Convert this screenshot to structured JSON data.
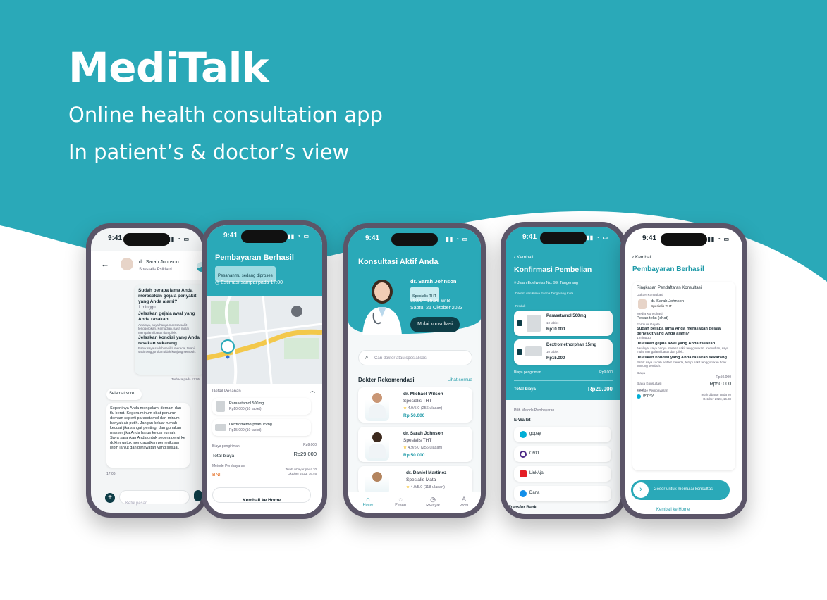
{
  "hero": {
    "title": "MediTalk",
    "subtitle1": "Online health consultation app",
    "subtitle2": "In patient’s & doctor’s view"
  },
  "colors": {
    "teal": "#2aa9b8",
    "dark": "#0e3d47",
    "bg": "#ffffff"
  },
  "status": {
    "time": "9:41"
  },
  "chat": {
    "doctor_name": "dr. Sarah Johnson",
    "doctor_spec": "Spesialis Psikiatri",
    "q1": "Sudah berapa lama Anda merasakan gejala penyakit yang Anda alami?",
    "a1": "1 minggu",
    "q2": "Jelaskan gejala awal yang Anda rasakan",
    "a2": "Awalnya, saya hanya merasa sakit tenggorokan. Kemudian, saya mulai mengalami batuk dan pilek.",
    "q3": "Jelaskan kondisi yang Anda rasakan sekarang",
    "a3": "Batuk saya sudah sedikit mereda, tetapi sakit tenggorokan tidak kunjung sembuh.",
    "read": "Terbaca pada 17:05",
    "greeting": "Selamat sore",
    "reply": "Sepertinya Anda mengalami demam dan flu berat. Segera minum obat penurun demam seperti parasetamol dan minum banyak air putih. Jangan keluar rumah kecuali jika sangat penting, dan gunakan masker jika Anda harus keluar rumah. Saya sarankan Anda untuk segera pergi ke dokter untuk mendapatkan pemeriksaan lebih lanjut dan perawatan yang sesuai.",
    "reply_time": "17:06",
    "input_placeholder": "Ketik pesan",
    "badge_time": "17:05"
  },
  "payment_map": {
    "title": "Pembayaran Berhasil",
    "status": "Pesananmu sedang diproses",
    "eta": "Estimasi sampai pada 17:00",
    "detail_label": "Detail Pesanan",
    "items": [
      {
        "name": "Parasetamol 500mg",
        "price": "Rp10.000 (10 tablet)"
      },
      {
        "name": "Dextromethorphan 15mg",
        "price": "Rp15.000 (10 tablet)"
      }
    ],
    "shipping_label": "Biaya pengiriman",
    "shipping": "Rp9.000",
    "total_label": "Total biaya",
    "total": "Rp29.000",
    "method_label": "Metode Pembayaran",
    "method": "BNI",
    "paid_on": "Telah dibayar pada 20 Oktober 2023, 16:46",
    "back": "Kembali ke Home"
  },
  "home": {
    "title": "Konsultasi Aktif Anda",
    "doctor_name": "dr. Sarah Johnson",
    "doctor_spec": "Spesialis THT",
    "time": "15.00 - 15.30 WIB",
    "date": "Sabtu, 21 Oktober 2023",
    "start_btn": "Mulai konsultasi",
    "search_placeholder": "Cari dokter atau spesialisasi",
    "rec_title": "Dokter Rekomendasi",
    "see_all": "Lihat semua",
    "doctors": [
      {
        "name": "dr. Michael Wilson",
        "spec": "Spesialis THT",
        "rating": "4.9/5.0 (256 ulasan)",
        "price": "Rp 50.000"
      },
      {
        "name": "dr. Sarah Johnson",
        "spec": "Spesialis THT",
        "rating": "4.9/5.0 (256 ulasan)",
        "price": "Rp 50.000"
      },
      {
        "name": "dr. Daniel Martinez",
        "spec": "Spesialis Mata",
        "rating": "4.9/5.0 (118 ulasan)",
        "price": ""
      }
    ],
    "nav": [
      "Home",
      "Pesan",
      "Riwayat",
      "Profil"
    ]
  },
  "checkout": {
    "back": "Kembali",
    "title": "Konfirmasi Pembelian",
    "address": "Jalan Edelweiss No. 99, Tangerang",
    "sender": "Dikirim dari Kimia Farma Tangerang Kota",
    "products_label": "Produk",
    "items": [
      {
        "name": "Parasetamol 500mg",
        "qty": "10 tablet",
        "price": "Rp10.000"
      },
      {
        "name": "Dextromethorphan 15mg",
        "qty": "10 tablet",
        "price": "Rp15.000"
      }
    ],
    "shipping_label": "Biaya pengiriman",
    "shipping": "Rp9.000",
    "total_label": "Total biaya",
    "total": "Rp29.000",
    "method_label": "Pilih Metode Pembayaran",
    "ewallet": "E-Wallet",
    "wallets": [
      "gopay",
      "OVO",
      "LinkAja",
      "Dana"
    ],
    "transfer": "Transfer Bank"
  },
  "summary": {
    "back": "Kembali",
    "title": "Pembayaran Berhasil",
    "heading": "Ringkasan Pendaftaran Konsultasi",
    "doctor_label": "Dokter Konsultasi",
    "doctor_name": "dr. Sarah Johnson",
    "doctor_spec": "Spesialis THT",
    "media_label": "Media Konsultasi",
    "media": "Pesan teks (chat)",
    "form_label": "Formulir Gejala",
    "q1": "Sudah berapa lama Anda merasakan gejala penyakit yang Anda alami?",
    "a1": "1 minggu",
    "q2": "Jelaskan gejala awal yang Anda rasakan",
    "a2": "Awalnya, saya hanya merasa sakit tenggorokan. Kemudian, saya mulai mengalami batuk dan pilek.",
    "q3": "Jelaskan kondisi yang Anda rasakan sekarang",
    "a3": "Batuk saya sudah sedikit mereda, tetapi sakit tenggorokan tidak kunjung sembuh.",
    "cost_label": "Biaya",
    "fee_label": "Biaya Konsultasi",
    "fee": "Rp50.000",
    "total_label": "Total",
    "total": "Rp50.000",
    "method_label": "Metode Pembayaran",
    "method": "gopay",
    "paid_on": "Telah dibayar pada 20 October 2023, 16.38",
    "swipe": "Geser untuk memulai konsultasi",
    "home": "Kembali ke Home"
  }
}
